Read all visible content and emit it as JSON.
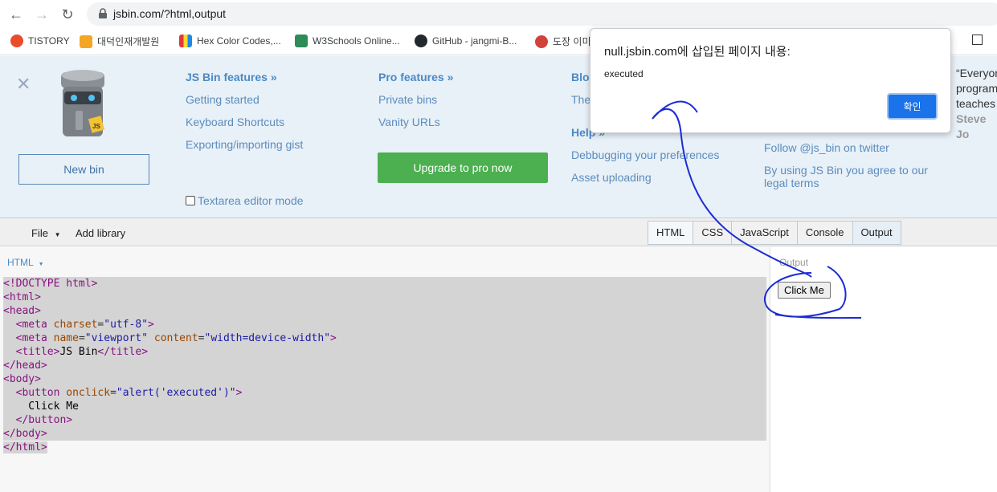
{
  "browser": {
    "url": "jsbin.com/?html,output"
  },
  "bookmarks": [
    {
      "label": "TISTORY",
      "icon": "tistory-icon",
      "color": "#e84c2b"
    },
    {
      "label": "대덕인재개발원",
      "icon": "daedeok-icon",
      "color": "#f5a623"
    },
    {
      "label": "Hex Color Codes,...",
      "icon": "hex-color-icon",
      "color": "#c0392b"
    },
    {
      "label": "W3Schools Online...",
      "icon": "w3schools-icon",
      "color": "#2e8b57"
    },
    {
      "label": "GitHub - jangmi-B...",
      "icon": "github-icon",
      "color": "#24292e"
    },
    {
      "label": "도장 이미",
      "icon": "stamp-icon",
      "color": "#d0433b"
    }
  ],
  "features": {
    "new_bin": "New bin",
    "col1": {
      "heading": "JS Bin features »",
      "links": [
        "Getting started",
        "Keyboard Shortcuts",
        "Exporting/importing gist"
      ]
    },
    "col2": {
      "heading": "Pro features »",
      "links": [
        "Private bins",
        "Vanity URLs"
      ],
      "upgrade": "Upgrade to pro now"
    },
    "col3": {
      "heading": "Blog",
      "blog_link": "The",
      "help_heading": "Help »",
      "help_links": [
        "Debbugging your preferences",
        "Asset uploading"
      ]
    },
    "col4": {
      "links": [
        "Follow @js_bin on twitter",
        "By using JS Bin you agree to our legal terms"
      ]
    },
    "textarea_mode": "Textarea editor mode",
    "quote": [
      "“Everyor",
      "program",
      "teaches",
      "Steve Jo"
    ]
  },
  "toolbar": {
    "file": "File",
    "add_library": "Add library",
    "tabs": [
      "HTML",
      "CSS",
      "JavaScript",
      "Console",
      "Output"
    ]
  },
  "editor": {
    "label": "HTML",
    "code_lines": [
      "<!DOCTYPE html>",
      "<html>",
      "<head>",
      "  <meta charset=\"utf-8\">",
      "  <meta name=\"viewport\" content=\"width=device-width\">",
      "  <title>JS Bin</title>",
      "</head>",
      "<body>",
      "  <button onclick=\"alert('executed')\">",
      "    Click Me",
      "  </button>",
      "</body>",
      "</html>"
    ]
  },
  "output": {
    "label": "Output",
    "button": "Click Me"
  },
  "dialog": {
    "title": "null.jsbin.com에 삽입된 페이지 내용:",
    "message": "executed",
    "ok": "확인"
  }
}
